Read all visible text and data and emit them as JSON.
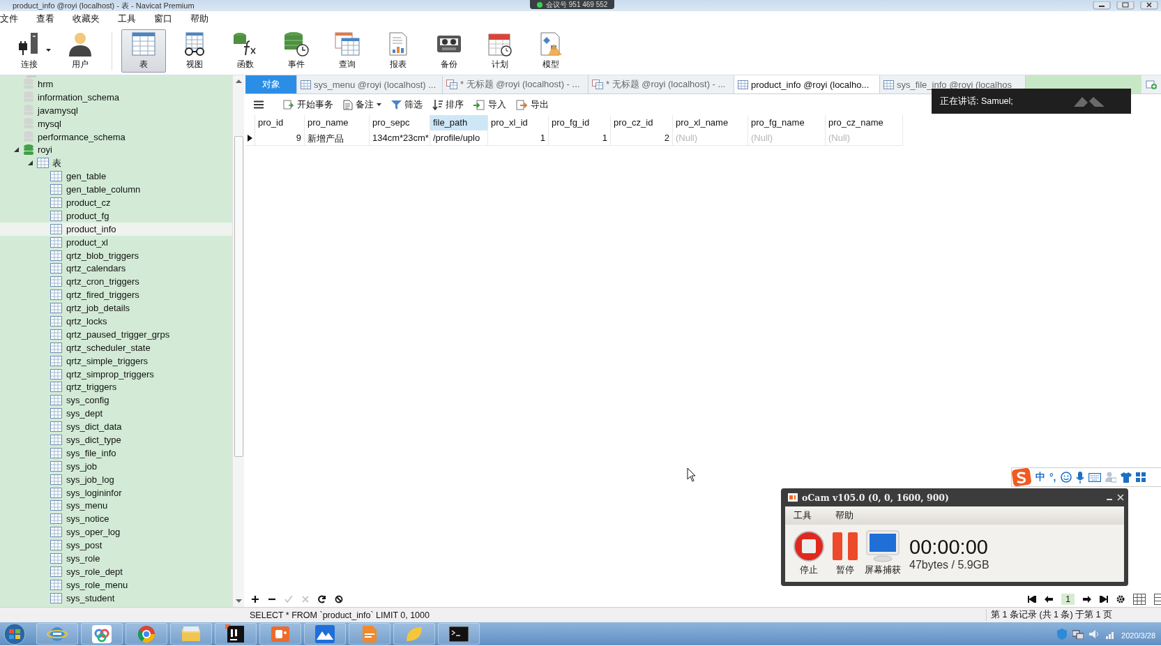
{
  "window": {
    "title": "product_info @royi (localhost) - 表 - Navicat Premium"
  },
  "meeting_banner": {
    "text": "会议号 951 469 552"
  },
  "menu": [
    "文件",
    "查看",
    "收藏夹",
    "工具",
    "窗口",
    "帮助"
  ],
  "toolbar": [
    {
      "kind": "connection",
      "label": "连接",
      "selected": false,
      "dropdown": true
    },
    {
      "kind": "user",
      "label": "用户",
      "selected": false,
      "dropdown": false
    },
    {
      "kind": "table",
      "label": "表",
      "selected": true,
      "dropdown": false
    },
    {
      "kind": "view",
      "label": "视图",
      "selected": false,
      "dropdown": false
    },
    {
      "kind": "function",
      "label": "函数",
      "selected": false,
      "dropdown": false
    },
    {
      "kind": "event",
      "label": "事件",
      "selected": false,
      "dropdown": false
    },
    {
      "kind": "query",
      "label": "查询",
      "selected": false,
      "dropdown": false
    },
    {
      "kind": "report",
      "label": "报表",
      "selected": false,
      "dropdown": false
    },
    {
      "kind": "backup",
      "label": "备份",
      "selected": false,
      "dropdown": false
    },
    {
      "kind": "schedule",
      "label": "计划",
      "selected": false,
      "dropdown": false
    },
    {
      "kind": "model",
      "label": "模型",
      "selected": false,
      "dropdown": false
    }
  ],
  "sidebar": {
    "databases": [
      {
        "label": "hrm",
        "open": false,
        "expanded": false
      },
      {
        "label": "information_schema",
        "open": false,
        "expanded": false
      },
      {
        "label": "javamysql",
        "open": false,
        "expanded": false
      },
      {
        "label": "mysql",
        "open": false,
        "expanded": false
      },
      {
        "label": "performance_schema",
        "open": false,
        "expanded": false
      },
      {
        "label": "royi",
        "open": true,
        "expanded": true,
        "children": [
          {
            "label": "表",
            "expanded": true,
            "children": [
              {
                "label": "gen_table",
                "selected": false
              },
              {
                "label": "gen_table_column",
                "selected": false
              },
              {
                "label": "product_cz",
                "selected": false
              },
              {
                "label": "product_fg",
                "selected": false
              },
              {
                "label": "product_info",
                "selected": true
              },
              {
                "label": "product_xl",
                "selected": false
              },
              {
                "label": "qrtz_blob_triggers",
                "selected": false
              },
              {
                "label": "qrtz_calendars",
                "selected": false
              },
              {
                "label": "qrtz_cron_triggers",
                "selected": false
              },
              {
                "label": "qrtz_fired_triggers",
                "selected": false
              },
              {
                "label": "qrtz_job_details",
                "selected": false
              },
              {
                "label": "qrtz_locks",
                "selected": false
              },
              {
                "label": "qrtz_paused_trigger_grps",
                "selected": false
              },
              {
                "label": "qrtz_scheduler_state",
                "selected": false
              },
              {
                "label": "qrtz_simple_triggers",
                "selected": false
              },
              {
                "label": "qrtz_simprop_triggers",
                "selected": false
              },
              {
                "label": "qrtz_triggers",
                "selected": false
              },
              {
                "label": "sys_config",
                "selected": false
              },
              {
                "label": "sys_dept",
                "selected": false
              },
              {
                "label": "sys_dict_data",
                "selected": false
              },
              {
                "label": "sys_dict_type",
                "selected": false
              },
              {
                "label": "sys_file_info",
                "selected": false
              },
              {
                "label": "sys_job",
                "selected": false
              },
              {
                "label": "sys_job_log",
                "selected": false
              },
              {
                "label": "sys_logininfor",
                "selected": false
              },
              {
                "label": "sys_menu",
                "selected": false
              },
              {
                "label": "sys_notice",
                "selected": false
              },
              {
                "label": "sys_oper_log",
                "selected": false
              },
              {
                "label": "sys_post",
                "selected": false
              },
              {
                "label": "sys_role",
                "selected": false
              },
              {
                "label": "sys_role_dept",
                "selected": false
              },
              {
                "label": "sys_role_menu",
                "selected": false
              },
              {
                "label": "sys_student",
                "selected": false
              }
            ]
          }
        ]
      }
    ]
  },
  "tabs": [
    {
      "kind": "objects",
      "label": "对象",
      "selected": false
    },
    {
      "kind": "table",
      "label": "sys_menu @royi (localhost) ...",
      "selected": false
    },
    {
      "kind": "query",
      "label": "* 无标题 @royi (localhost) - ...",
      "selected": false
    },
    {
      "kind": "query",
      "label": "* 无标题 @royi (localhost) - ...",
      "selected": false
    },
    {
      "kind": "table",
      "label": "product_info @royi (localho...",
      "selected": true
    },
    {
      "kind": "table",
      "label": "sys_file_info @royi (localhos",
      "selected": false
    }
  ],
  "grid_toolbar": [
    {
      "kind": "menu"
    },
    {
      "kind": "transaction",
      "label": "开始事务"
    },
    {
      "kind": "memo",
      "label": "备注"
    },
    {
      "kind": "filter",
      "label": "筛选"
    },
    {
      "kind": "sort",
      "label": "排序"
    },
    {
      "kind": "import",
      "label": "导入"
    },
    {
      "kind": "export",
      "label": "导出"
    }
  ],
  "table": {
    "columns": [
      {
        "label": "pro_id",
        "selected": false
      },
      {
        "label": "pro_name",
        "selected": false
      },
      {
        "label": "pro_sepc",
        "selected": false
      },
      {
        "label": "file_path",
        "selected": true
      },
      {
        "label": "pro_xl_id",
        "selected": false
      },
      {
        "label": "pro_fg_id",
        "selected": false
      },
      {
        "label": "pro_cz_id",
        "selected": false
      },
      {
        "label": "pro_xl_name",
        "selected": false
      },
      {
        "label": "pro_fg_name",
        "selected": false
      },
      {
        "label": "pro_cz_name",
        "selected": false
      }
    ],
    "rows": [
      {
        "current": true,
        "cells": [
          {
            "kind": "number",
            "text": "9"
          },
          {
            "kind": "text",
            "text": "新增产品"
          },
          {
            "kind": "text",
            "text": "134cm*23cm*"
          },
          {
            "kind": "text",
            "text": "/profile/uplo"
          },
          {
            "kind": "number",
            "text": "1"
          },
          {
            "kind": "number",
            "text": "1"
          },
          {
            "kind": "number",
            "text": "2"
          },
          {
            "kind": "null",
            "text": "(Null)"
          },
          {
            "kind": "null",
            "text": "(Null)"
          },
          {
            "kind": "null",
            "text": "(Null)"
          }
        ]
      }
    ]
  },
  "grid_actions": [
    {
      "kind": "add",
      "disabled": false
    },
    {
      "kind": "remove",
      "disabled": false
    },
    {
      "kind": "apply",
      "disabled": true
    },
    {
      "kind": "cancel",
      "disabled": true
    },
    {
      "kind": "refresh",
      "disabled": false
    },
    {
      "kind": "stop",
      "disabled": false
    }
  ],
  "pager": {
    "page": "1"
  },
  "status_bar": {
    "sql": "SELECT * FROM `product_info` LIMIT 0, 1000",
    "records": "第 1 条记录 (共 1 条) 于第 1 页"
  },
  "tooltip": {
    "text": "正在讲话: Samuel;"
  },
  "ime_bar": {
    "mode": "中",
    "punct": "°,"
  },
  "ocam": {
    "title": "oCam v105.0 (0, 0, 1600, 900)",
    "menu": [
      "工具",
      "帮助"
    ],
    "buttons": [
      {
        "kind": "stop",
        "label": "停止"
      },
      {
        "kind": "pause",
        "label": "暂停"
      },
      {
        "kind": "screen",
        "label": "屏幕捕获"
      }
    ],
    "timer": "00:00:00",
    "size": "47bytes / 5.9GB"
  },
  "taskbar": {
    "apps": [
      {
        "kind": "ie"
      },
      {
        "kind": "cloud"
      },
      {
        "kind": "chrome"
      },
      {
        "kind": "folder"
      },
      {
        "kind": "ide"
      },
      {
        "kind": "ocam"
      },
      {
        "kind": "mountain"
      },
      {
        "kind": "pdf"
      },
      {
        "kind": "leaf"
      },
      {
        "kind": "terminal"
      }
    ],
    "date": "2020/3/28"
  }
}
